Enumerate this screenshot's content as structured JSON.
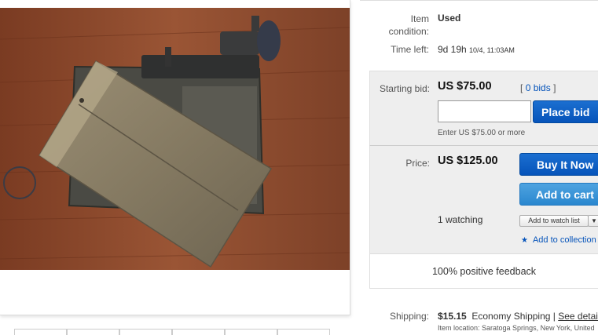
{
  "item": {
    "condition_label": "Item condition:",
    "condition_value": "Used",
    "time_left_label": "Time left:",
    "time_left_value": "9d 19h",
    "time_left_end": "10/4, 11:03AM"
  },
  "bid": {
    "starting_bid_label": "Starting bid:",
    "starting_bid_value": "US $75.00",
    "bids_open": "[",
    "bids_link": "0 bids",
    "bids_close": "]",
    "input_value": "",
    "place_bid_label": "Place bid",
    "hint": "Enter US $75.00 or more"
  },
  "buy": {
    "price_label": "Price:",
    "price_value": "US $125.00",
    "buy_now_label": "Buy It Now",
    "add_to_cart_label": "Add to cart",
    "watching_text": "1 watching",
    "add_to_watch_list_label": "Add to watch list",
    "add_to_collection_label": "Add to collection"
  },
  "feedback": {
    "text": "100% positive feedback"
  },
  "shipping": {
    "label": "Shipping:",
    "cost": "$15.15",
    "method": "Economy Shipping",
    "separator": "|",
    "details_link": "See details",
    "location": "Item location:  Saratoga Springs, New York, United"
  },
  "icons": {
    "star": "star-icon",
    "caret": "chevron-down-icon"
  },
  "colors": {
    "link_blue": "#0654ba",
    "button_blue": "#0654ba",
    "cart_blue": "#2a87cf",
    "panel_gray": "#eeeeee"
  }
}
